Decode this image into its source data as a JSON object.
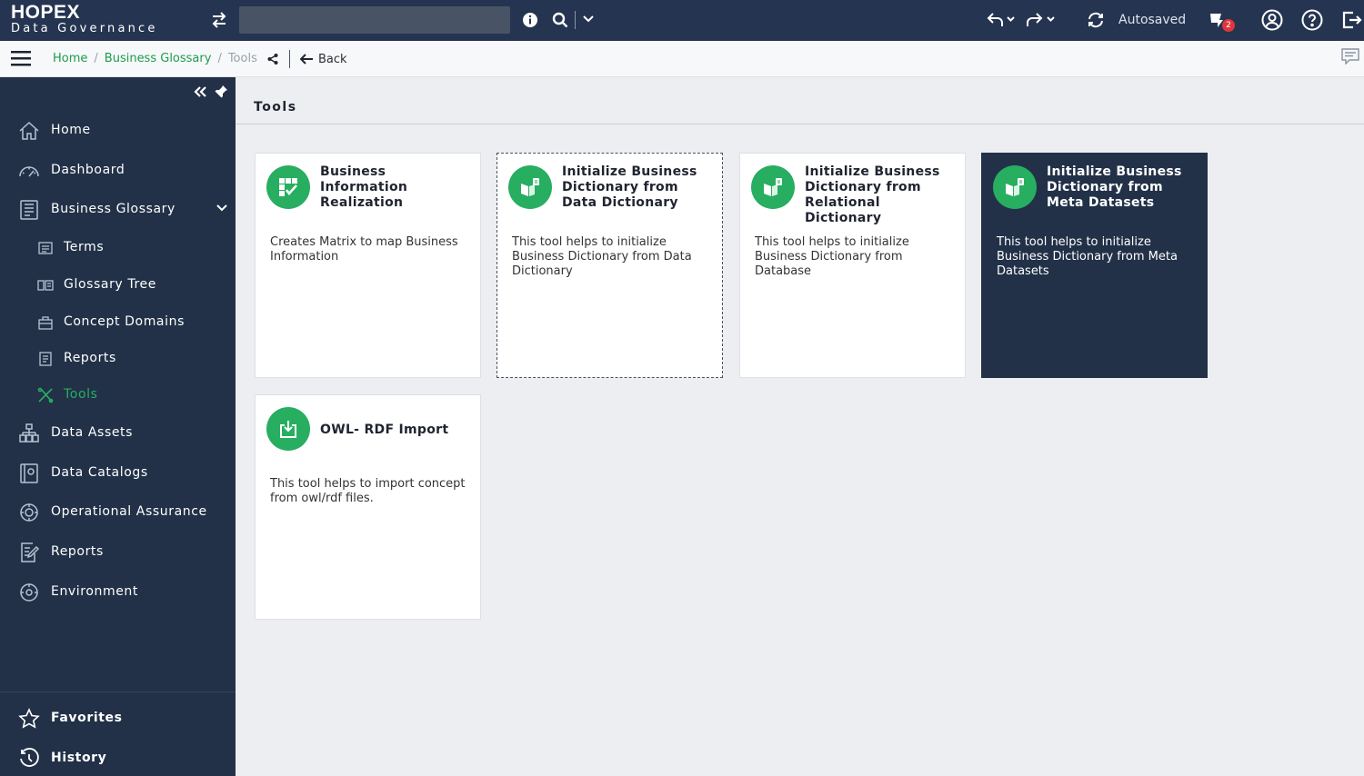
{
  "app": {
    "brand_title": "HOPEX",
    "brand_subtitle": "Data Governance",
    "search_placeholder": "",
    "autosaved_label": "Autosaved",
    "notification_count": "2"
  },
  "breadcrumb": {
    "items": [
      "Home",
      "Business Glossary"
    ],
    "separator": "/",
    "current": "Tools",
    "back_label": "Back"
  },
  "sidebar": {
    "items": [
      {
        "label": "Home",
        "icon": "home-icon"
      },
      {
        "label": "Dashboard",
        "icon": "dashboard-gauge-icon"
      },
      {
        "label": "Business Glossary",
        "icon": "glossary-book-icon",
        "expanded": true
      },
      {
        "label": "Terms",
        "icon": "terms-icon"
      },
      {
        "label": "Glossary Tree",
        "icon": "tree-icon"
      },
      {
        "label": "Concept Domains",
        "icon": "concept-domain-icon"
      },
      {
        "label": "Reports",
        "icon": "report-icon"
      },
      {
        "label": "Tools",
        "icon": "tools-icon",
        "active": true
      },
      {
        "label": "Data Assets",
        "icon": "data-assets-icon"
      },
      {
        "label": "Data Catalogs",
        "icon": "data-catalog-icon"
      },
      {
        "label": "Operational Assurance",
        "icon": "assurance-icon"
      },
      {
        "label": "Reports",
        "icon": "reports-edit-icon"
      },
      {
        "label": "Environment",
        "icon": "environment-icon"
      }
    ],
    "bottom": [
      {
        "label": "Favorites",
        "icon": "star-icon"
      },
      {
        "label": "History",
        "icon": "history-icon"
      }
    ]
  },
  "main": {
    "title": "Tools",
    "cards": [
      {
        "title": "Business Information Realization",
        "description": "Creates Matrix to map Business Information",
        "icon": "matrix-icon"
      },
      {
        "title": "Initialize Business Dictionary from Data Dictionary",
        "description": "This tool helps to initialize Business Dictionary from Data Dictionary",
        "icon": "dictionary-init-icon"
      },
      {
        "title": "Initialize Business Dictionary from Relational Dictionary",
        "description": "This tool helps to initialize Business Dictionary from Database",
        "icon": "dictionary-init-icon"
      },
      {
        "title": "Initialize Business Dictionary from Meta Datasets",
        "description": "This tool helps to initialize Business Dictionary from Meta Datasets",
        "icon": "dictionary-init-icon"
      },
      {
        "title": "OWL- RDF Import",
        "description": "This tool helps to import concept from owl/rdf files.",
        "icon": "import-icon"
      }
    ]
  },
  "colors": {
    "topbar": "#253450",
    "sidebar": "#223148",
    "accent_green": "#27ae60",
    "link_green": "#1d9c4c",
    "background": "#eceef1"
  }
}
